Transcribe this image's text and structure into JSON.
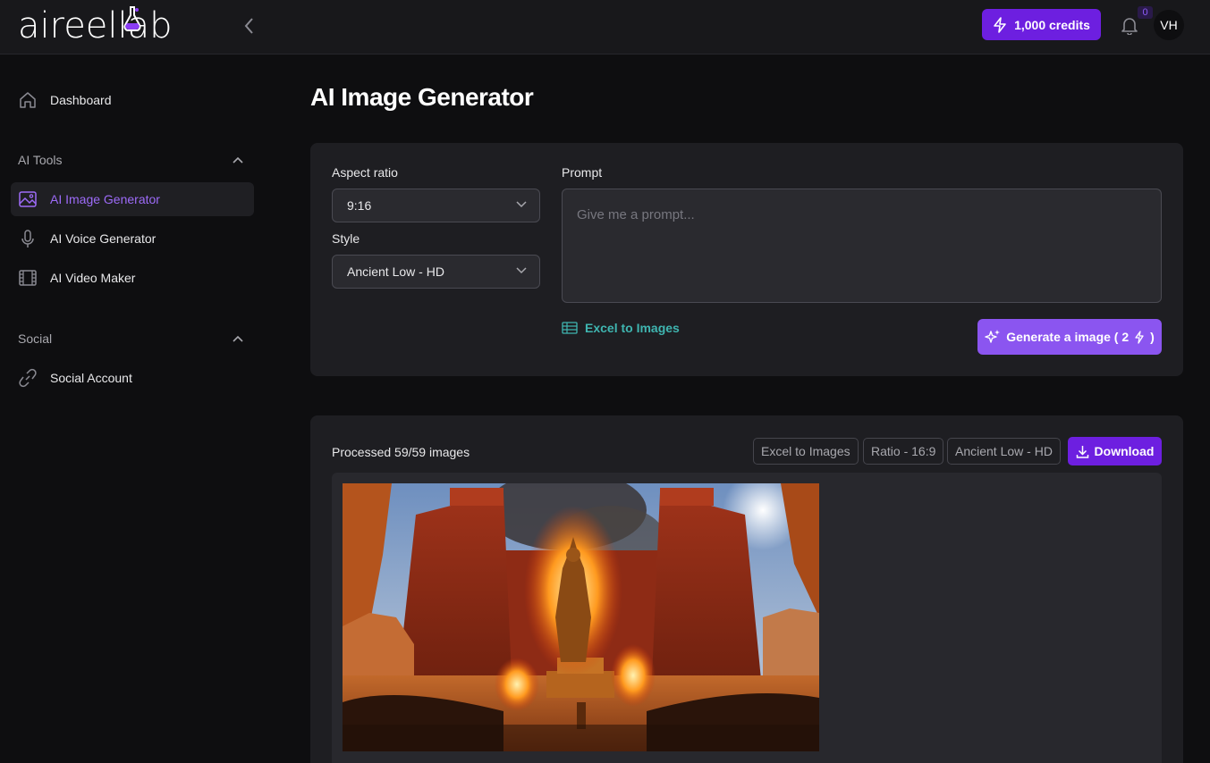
{
  "header": {
    "logo_text": "aireellab",
    "credits_label": "1,000 credits",
    "notification_count": "0",
    "avatar_initials": "VH"
  },
  "sidebar": {
    "dashboard_label": "Dashboard",
    "sections": [
      {
        "title": "AI Tools",
        "items": [
          {
            "label": "AI Image Generator",
            "icon": "image-icon",
            "active": true
          },
          {
            "label": "AI Voice Generator",
            "icon": "microphone-icon"
          },
          {
            "label": "AI Video Maker",
            "icon": "film-icon"
          }
        ]
      },
      {
        "title": "Social",
        "items": [
          {
            "label": "Social Account",
            "icon": "link-icon"
          }
        ]
      }
    ]
  },
  "main": {
    "title": "AI Image Generator",
    "form": {
      "aspect_ratio_label": "Aspect ratio",
      "aspect_ratio_value": "9:16",
      "style_label": "Style",
      "style_value": "Ancient Low - HD",
      "prompt_label": "Prompt",
      "prompt_placeholder": "Give me a prompt...",
      "excel_link": "Excel to Images",
      "generate_label": "Generate a image ( 2",
      "generate_suffix": ")"
    },
    "results": {
      "processed": "Processed 59/59 images",
      "chips": [
        "Excel to Images",
        "Ratio - 16:9",
        "Ancient Low - HD"
      ],
      "download_label": "Download"
    }
  },
  "colors": {
    "accent": "#6d1fe0",
    "accent_light": "#8b55f0",
    "active_text": "#9d6bf8",
    "link_teal": "#3fb5b0"
  }
}
